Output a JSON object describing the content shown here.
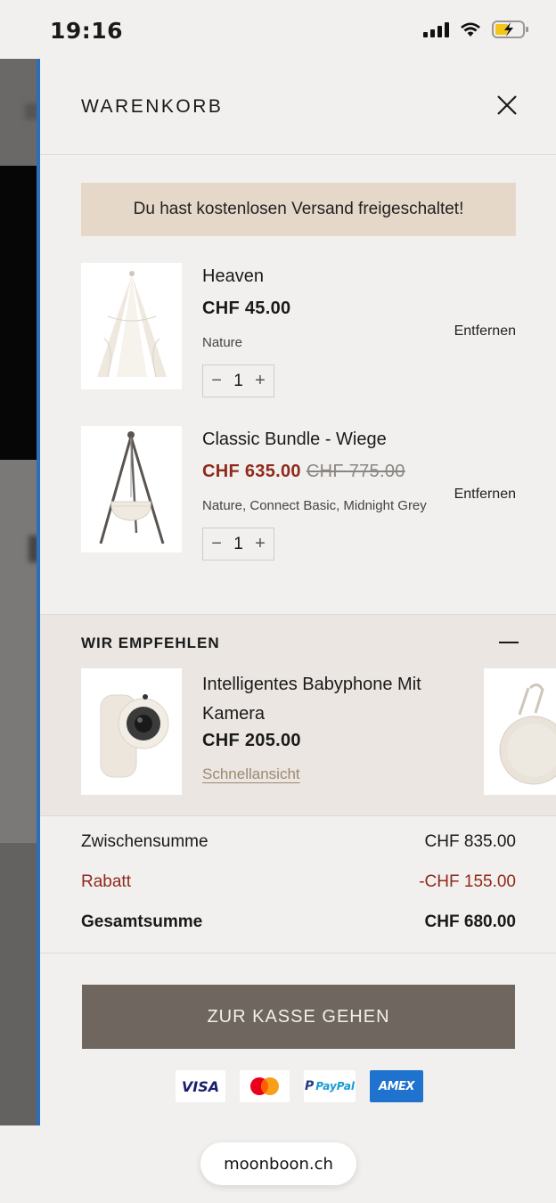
{
  "status_bar": {
    "time": "19:16"
  },
  "cart": {
    "title": "WARENKORB",
    "shipping_banner": "Du hast kostenlosen Versand freigeschaltet!",
    "items": [
      {
        "name": "Heaven",
        "price": "CHF 45.00",
        "old_price": "",
        "variant": "Nature",
        "qty": "1",
        "remove_label": "Entfernen"
      },
      {
        "name": "Classic Bundle - Wiege",
        "price": "CHF 635.00",
        "old_price": "CHF 775.00",
        "variant": "Nature, Connect Basic, Midnight Grey",
        "qty": "1",
        "remove_label": "Entfernen"
      }
    ]
  },
  "recommendations": {
    "title": "WIR EMPFEHLEN",
    "items": [
      {
        "name": "Intelligentes Babyphone Mit Kamera",
        "price": "CHF 205.00",
        "link": "Schnellansicht"
      }
    ]
  },
  "totals": {
    "subtotal_label": "Zwischensumme",
    "subtotal_value": "CHF 835.00",
    "discount_label": "Rabatt",
    "discount_value": "-CHF 155.00",
    "total_label": "Gesamtsumme",
    "total_value": "CHF 680.00"
  },
  "checkout": {
    "label": "ZUR KASSE GEHEN"
  },
  "payments": {
    "visa": "VISA",
    "paypal_p": "P",
    "paypal": "PayPal",
    "amex": "AMEX"
  },
  "browser": {
    "url": "moonboon.ch"
  },
  "colors": {
    "accent": "#2a6fb8",
    "banner": "#e6d8c9",
    "sale": "#8f2a1b",
    "checkout": "#6e665f",
    "link": "#9b8a72"
  }
}
